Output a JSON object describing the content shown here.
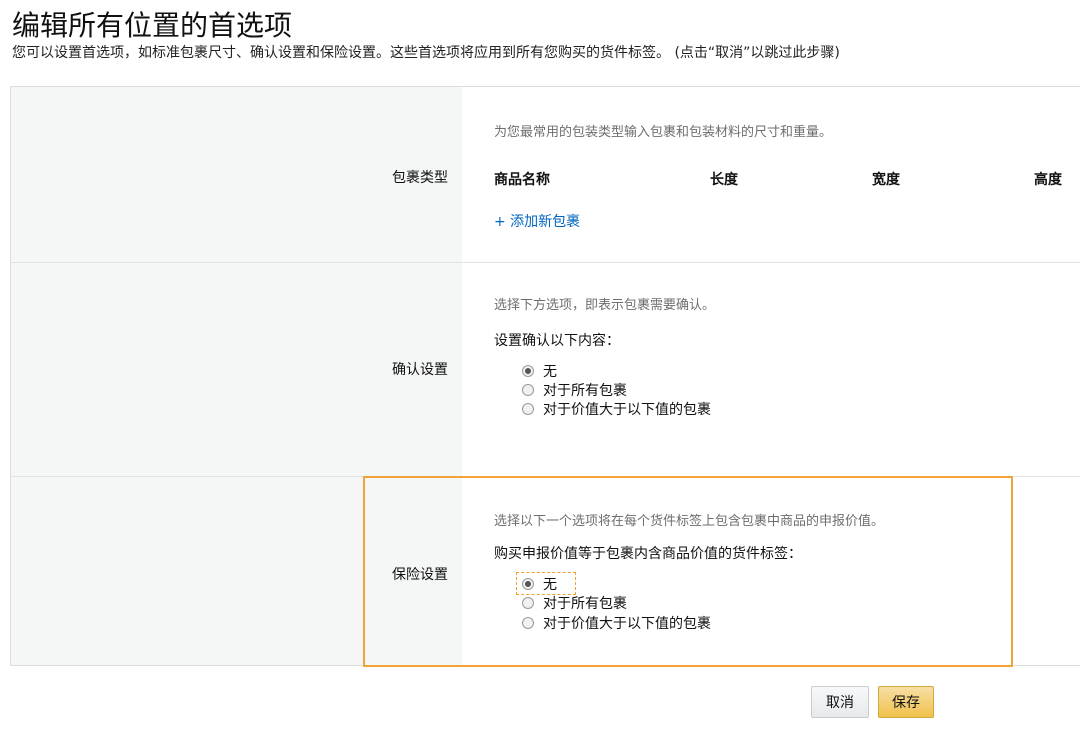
{
  "header": {
    "title": "编辑所有位置的首选项",
    "subtitle": "您可以设置首选项，如标准包裹尺寸、确认设置和保险设置。这些首选项将应用到所有您购买的货件标签。 (点击“取消”以跳过此步骤)"
  },
  "package_types": {
    "label": "包裹类型",
    "hint": "为您最常用的包装类型输入包裹和包装材料的尺寸和重量。",
    "columns": [
      "商品名称",
      "长度",
      "宽度",
      "高度"
    ],
    "add_link": "+ 添加新包裹"
  },
  "confirmation": {
    "label": "确认设置",
    "hint": "选择下方选项，即表示包裹需要确认。",
    "prompt": "设置确认以下内容：",
    "options": [
      "无",
      "对于所有包裹",
      "对于价值大于以下值的包裹"
    ],
    "selected": 0
  },
  "insurance": {
    "label": "保险设置",
    "hint": "选择以下一个选项将在每个货件标签上包含包裹中商品的申报价值。",
    "prompt": "购买申报价值等于包裹内含商品价值的货件标签：",
    "options": [
      "无",
      "对于所有包裹",
      "对于价值大于以下值的包裹"
    ],
    "selected": 0
  },
  "actions": {
    "cancel": "取消",
    "save": "保存"
  },
  "colors": {
    "accent_link": "#0066c0",
    "highlight_border": "#f2a33a",
    "save_button": "#f0c14b"
  }
}
